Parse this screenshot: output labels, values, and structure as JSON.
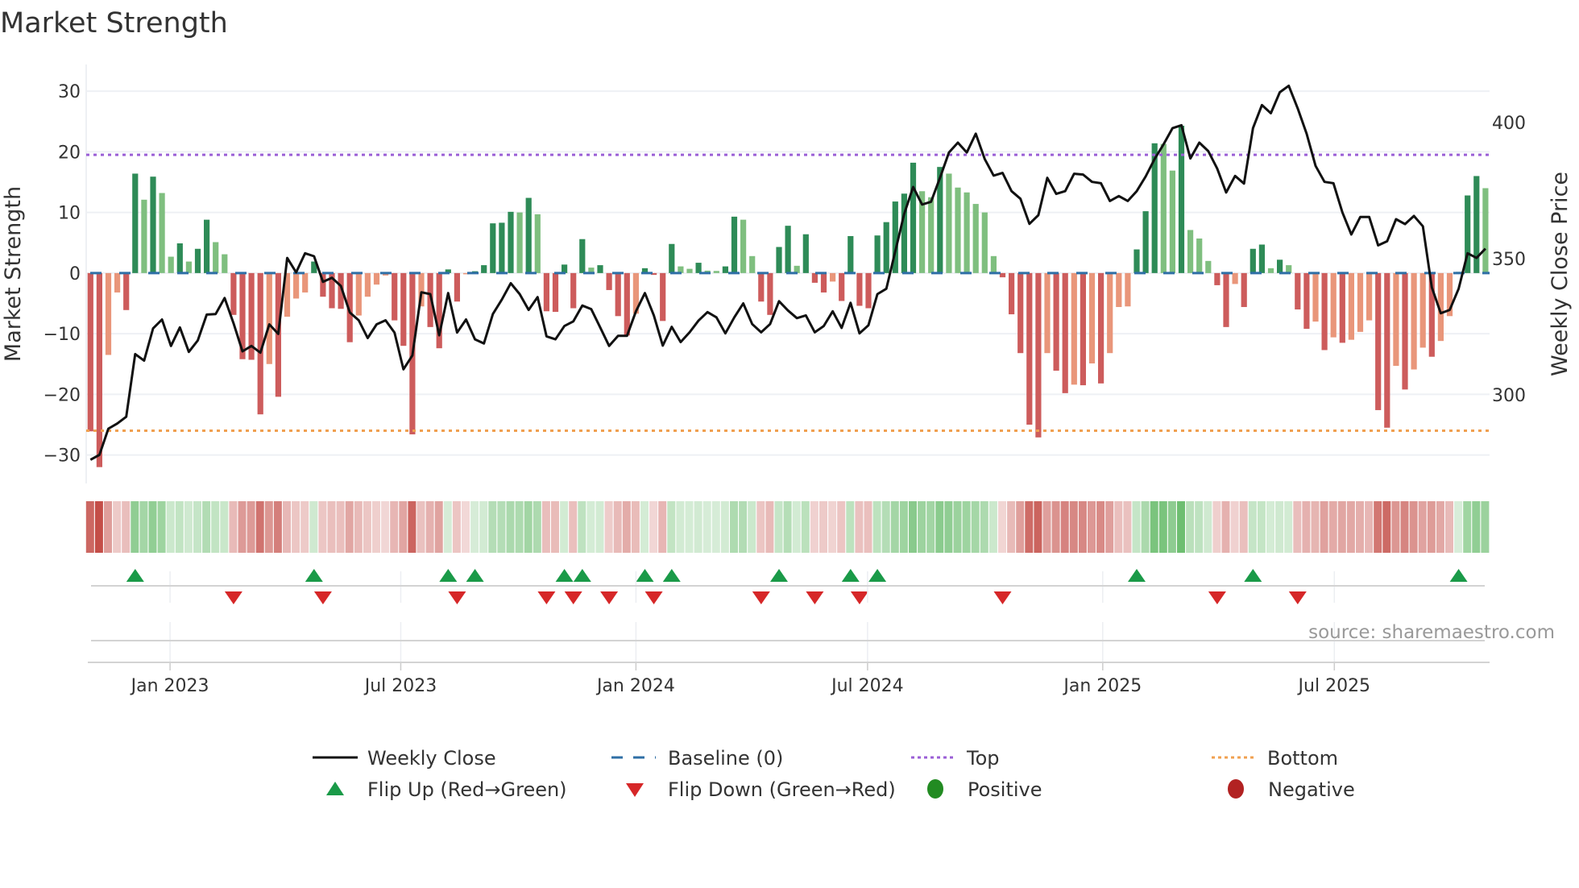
{
  "chart_data": {
    "type": "bar+line",
    "title": "Market Strength",
    "ylabel_left": "Market Strength",
    "ylabel_right": "Weekly Close Price",
    "x_start": "2022-11-04",
    "x_step_days": 7,
    "x_tick_labels": [
      "Jan 2023",
      "Jul 2023",
      "Jan 2024",
      "Jul 2024",
      "Jan 2025",
      "Jul 2025"
    ],
    "x_tick_weeks": [
      8.9,
      34.7,
      61.0,
      86.9,
      113.2,
      139.1
    ],
    "ylim_left": [
      -34.7,
      34.4
    ],
    "yticks_left": [
      {
        "v": 30,
        "label": "30"
      },
      {
        "v": 20,
        "label": "20"
      },
      {
        "v": 10,
        "label": "10"
      },
      {
        "v": 0,
        "label": "0"
      },
      {
        "v": -10,
        "label": "−10"
      },
      {
        "v": -20,
        "label": "−20"
      },
      {
        "v": -30,
        "label": "−30"
      }
    ],
    "ylim_right": [
      267.5,
      421.3
    ],
    "yticks_right": [
      {
        "v": 400,
        "label": "400"
      },
      {
        "v": 350,
        "label": "350"
      },
      {
        "v": 300,
        "label": "300"
      }
    ],
    "top_level": 19.5,
    "bottom_level": -26,
    "baseline": 0,
    "grid": true,
    "legend_placement": "bottom",
    "strength": [
      -26.1,
      -32,
      -13.5,
      -3.2,
      -6.1,
      16.4,
      12.1,
      15.9,
      13.2,
      2.7,
      4.9,
      1.9,
      4.0,
      8.8,
      5.1,
      3.1,
      -6.9,
      -14.2,
      -14.3,
      -23.3,
      -15,
      -20.4,
      -7.2,
      -4.2,
      -3.2,
      1.9,
      -3.9,
      -5.8,
      -5.9,
      -11.4,
      -7,
      -3.9,
      -1.9,
      -0.4,
      -7.8,
      -12,
      -26.6,
      -5.5,
      -8.9,
      -12.4,
      0.6,
      -4.7,
      -0.2,
      0.3,
      1.3,
      8.2,
      8.3,
      10.1,
      10.0,
      12.4,
      9.7,
      -6.3,
      -6.4,
      1.4,
      -5.8,
      5.6,
      0.9,
      1.3,
      -2.8,
      -7.1,
      -10.3,
      -6.7,
      0.8,
      -0.3,
      -7.9,
      4.8,
      1.1,
      0.7,
      1.7,
      0.4,
      0.35,
      1.1,
      9.3,
      8.8,
      2.8,
      -4.7,
      -6.9,
      4.3,
      7.8,
      1.2,
      6.4,
      -1.6,
      -3.2,
      -1.4,
      -4.6,
      6.1,
      -5.4,
      -5.8,
      6.2,
      8.4,
      11.8,
      13.1,
      18.2,
      13.5,
      12.5,
      17.5,
      16.4,
      14.1,
      13.3,
      11.4,
      10,
      2.8,
      -0.7,
      -6.8,
      -13.2,
      -25,
      -27.1,
      -13.2,
      -16.1,
      -19.8,
      -18.4,
      -18.5,
      -14.9,
      -18.2,
      -13.2,
      -5.6,
      -5.5,
      3.9,
      10.2,
      21.4,
      21.3,
      16.9,
      24.3,
      7.1,
      5.7,
      2,
      -2,
      -8.9,
      -1.8,
      -5.6,
      4,
      4.7,
      0.8,
      2.2,
      1.3,
      -6,
      -9.2,
      -8,
      -12.7,
      -10.6,
      -11.5,
      -11,
      -9.7,
      -7.8,
      -22.6,
      -25.5,
      -15.3,
      -19.2,
      -15.9,
      -12.3,
      -13.8,
      -11.2,
      -7.1,
      0.2,
      12.8,
      16,
      14
    ],
    "weekly_close": [
      276.2,
      278,
      287.6,
      289.5,
      292,
      315,
      312.6,
      324.4,
      327.7,
      318,
      324.8,
      315.8,
      320,
      329.5,
      329.7,
      335.6,
      326.3,
      316,
      318,
      315.5,
      325.9,
      322.4,
      350.3,
      345,
      352,
      350.9,
      341.5,
      343,
      340,
      330.3,
      327.4,
      320.9,
      325.9,
      327.4,
      322.9,
      309.4,
      314.5,
      337.7,
      337,
      321.9,
      337.4,
      322.9,
      327.7,
      320.4,
      318.9,
      329.7,
      335,
      341,
      337,
      331.2,
      335.9,
      321.5,
      320.4,
      325.3,
      327,
      332.8,
      331.5,
      324.8,
      318,
      321.7,
      321.7,
      330.7,
      337.4,
      329.2,
      318.1,
      325,
      319.4,
      323,
      327.3,
      330.4,
      328.5,
      322.6,
      328.5,
      333.6,
      326,
      323,
      326,
      334.4,
      331,
      328.2,
      329.2,
      323,
      325.3,
      330.7,
      324.6,
      333.8,
      322.6,
      325.6,
      337,
      339,
      352.7,
      366.5,
      376.3,
      369.9,
      370.9,
      379.7,
      389,
      392.6,
      389,
      395.9,
      386.6,
      380.5,
      381.5,
      374.8,
      372,
      362.8,
      366,
      379.7,
      373.8,
      374.8,
      381.2,
      380.9,
      378.2,
      377.7,
      371.2,
      373,
      371.2,
      374.8,
      380.2,
      386.6,
      392,
      397.9,
      399,
      386.8,
      392.6,
      389.5,
      383.1,
      374.3,
      380.4,
      377.6,
      397.9,
      406.4,
      403.4,
      411.1,
      413.5,
      405.2,
      395.9,
      384.1,
      378.2,
      377.7,
      367,
      358.9,
      365.3,
      365.3,
      354.9,
      356.4,
      364.5,
      362.7,
      365.7,
      361.9,
      339.5,
      330,
      331.2,
      339,
      352,
      350.3,
      353.7
    ],
    "flip_up_weeks": [
      5,
      25,
      40,
      43,
      53,
      55,
      62,
      65,
      77,
      85,
      88,
      117,
      130,
      153
    ],
    "flip_down_weeks": [
      16,
      26,
      41,
      51,
      54,
      58,
      63,
      75,
      81,
      86,
      102,
      126,
      135
    ],
    "legend": [
      {
        "label": "Weekly Close",
        "kind": "line"
      },
      {
        "label": "Baseline (0)",
        "kind": "baseline"
      },
      {
        "label": "Top",
        "kind": "top"
      },
      {
        "label": "Bottom",
        "kind": "bottom"
      },
      {
        "label": "Flip Up (Red→Green)",
        "kind": "up"
      },
      {
        "label": "Flip Down (Green→Red)",
        "kind": "down"
      },
      {
        "label": "Positive",
        "kind": "pos"
      },
      {
        "label": "Negative",
        "kind": "neg"
      }
    ],
    "source": "source: sharemaestro.com",
    "colors": {
      "pos_strong": "#2e8b57",
      "pos_weak": "#7fbf7f",
      "neg_strong": "#cd5c5c",
      "neg_weak": "#e9967a",
      "line": "#111111",
      "baseline": "#2f6fa6",
      "top": "#9b5fd6",
      "bottom": "#f0a050",
      "flip_up": "#1a9a48",
      "flip_down": "#d62728",
      "positive": "#228b22",
      "negative": "#b22222"
    }
  }
}
